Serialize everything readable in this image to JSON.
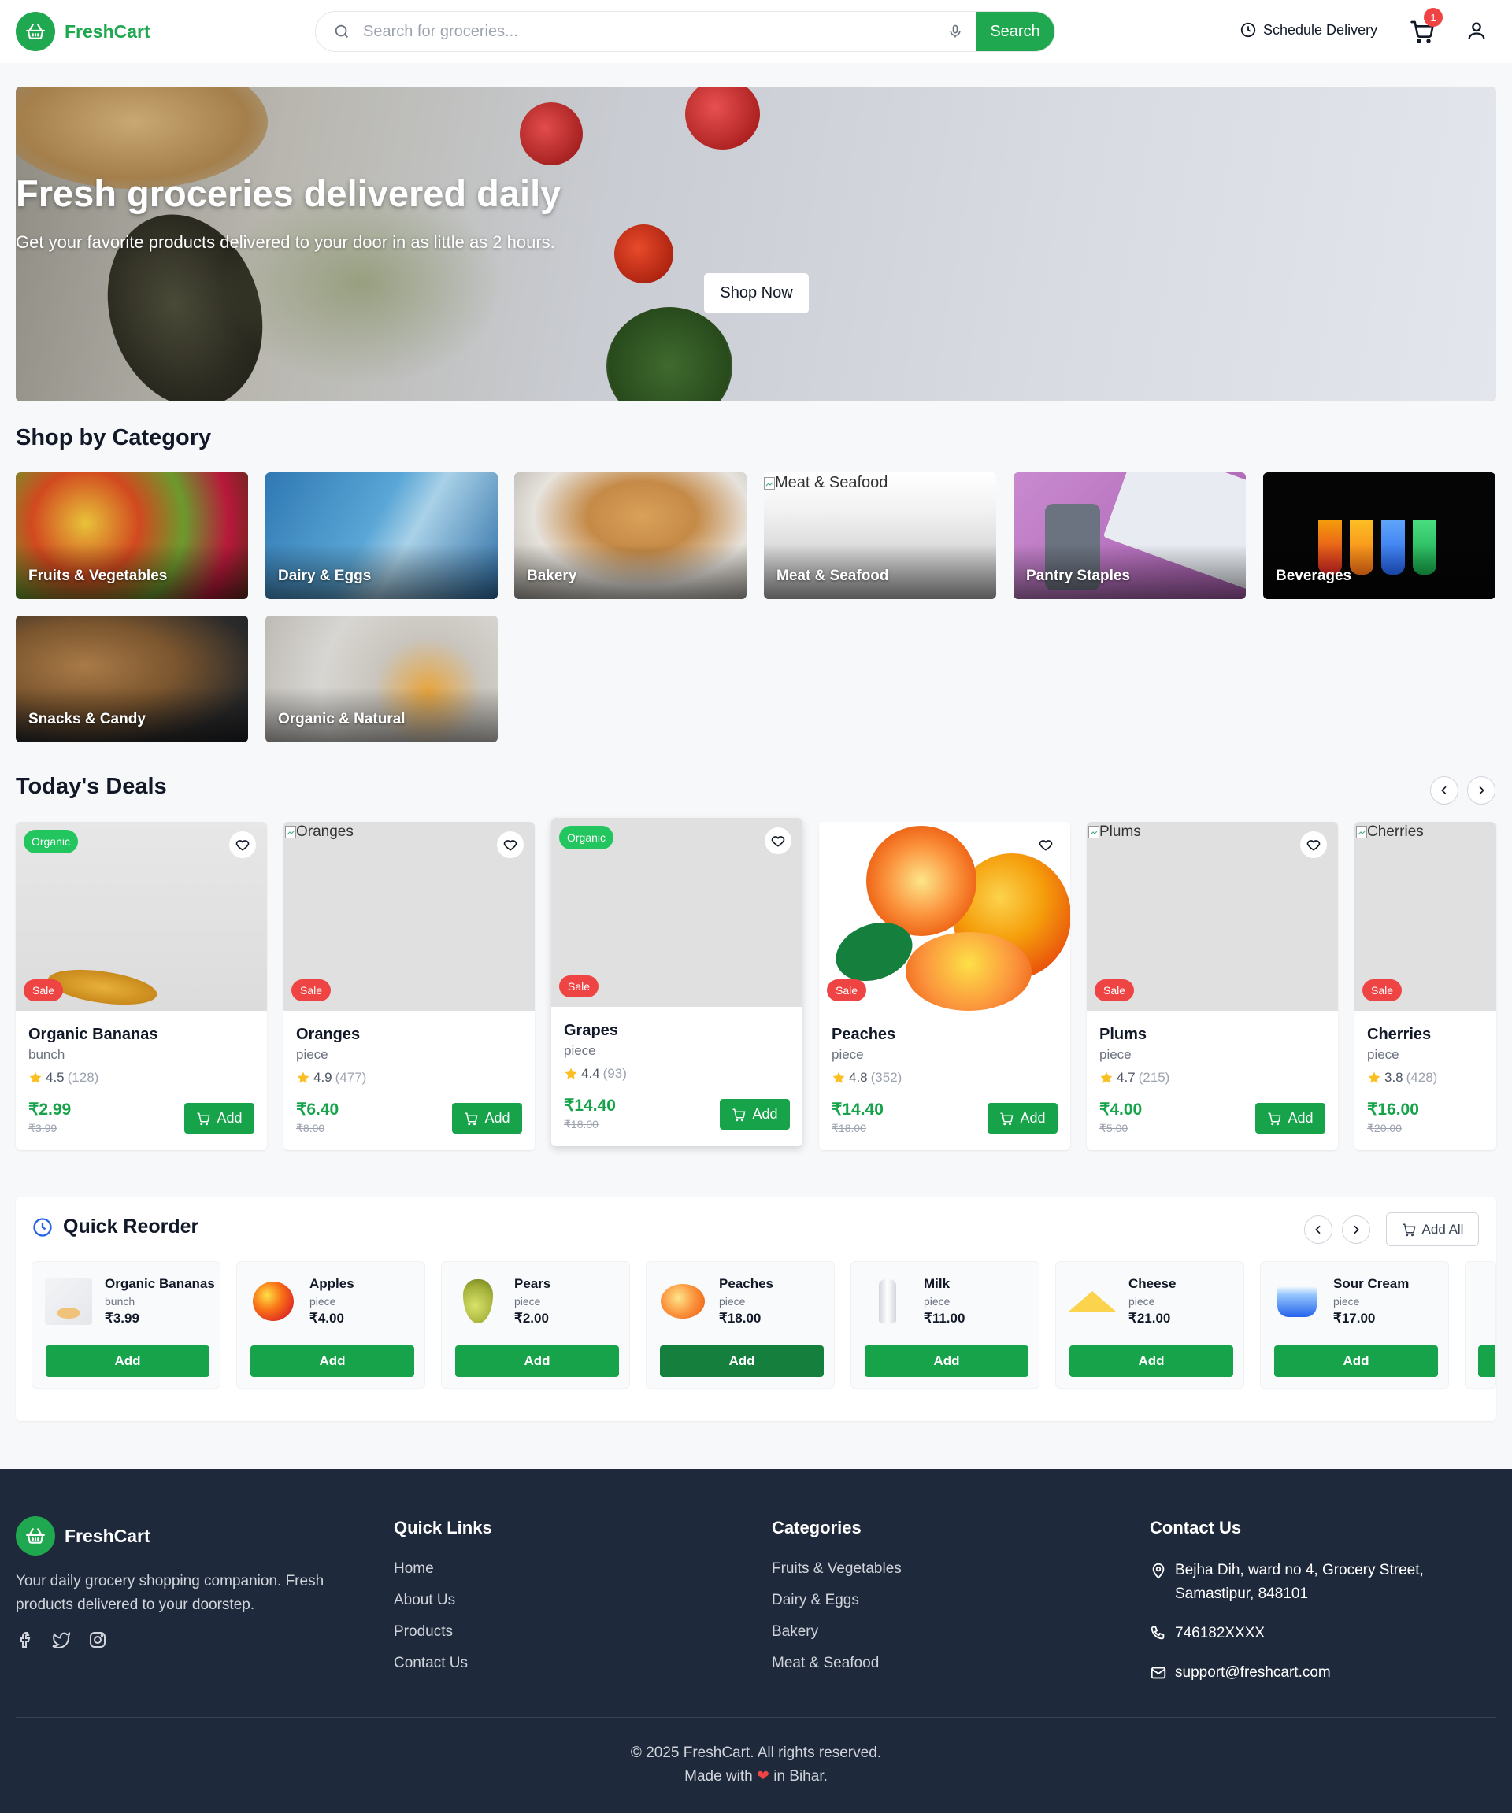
{
  "brand": {
    "name": "FreshCart"
  },
  "header": {
    "search_placeholder": "Search for groceries...",
    "search_button": "Search",
    "schedule_label": "Schedule Delivery",
    "cart_count": "1"
  },
  "hero": {
    "title": "Fresh groceries delivered daily",
    "subtitle": "Get your favorite products delivered to your door in as little as 2 hours.",
    "cta": "Shop Now"
  },
  "categories": {
    "title": "Shop by Category",
    "items": [
      {
        "label": "Fruits & Vegetables"
      },
      {
        "label": "Dairy & Eggs"
      },
      {
        "label": "Bakery"
      },
      {
        "label": "Meat & Seafood",
        "alt": "Meat & Seafood"
      },
      {
        "label": "Pantry Staples"
      },
      {
        "label": "Beverages"
      },
      {
        "label": "Snacks & Candy"
      },
      {
        "label": "Organic & Natural"
      }
    ]
  },
  "deals": {
    "title": "Today's Deals",
    "add_label": "Add",
    "items": [
      {
        "name": "Organic Bananas",
        "unit": "bunch",
        "rating": "4.5",
        "reviews": "(128)",
        "price": "₹2.99",
        "old_price": "₹3.99",
        "organic": "Organic",
        "sale": "Sale"
      },
      {
        "name": "Oranges",
        "unit": "piece",
        "rating": "4.9",
        "reviews": "(477)",
        "price": "₹6.40",
        "old_price": "₹8.00",
        "sale": "Sale",
        "alt": "Oranges"
      },
      {
        "name": "Grapes",
        "unit": "piece",
        "rating": "4.4",
        "reviews": "(93)",
        "price": "₹14.40",
        "old_price": "₹18.00",
        "organic": "Organic",
        "sale": "Sale"
      },
      {
        "name": "Peaches",
        "unit": "piece",
        "rating": "4.8",
        "reviews": "(352)",
        "price": "₹14.40",
        "old_price": "₹18.00",
        "sale": "Sale"
      },
      {
        "name": "Plums",
        "unit": "piece",
        "rating": "4.7",
        "reviews": "(215)",
        "price": "₹4.00",
        "old_price": "₹5.00",
        "sale": "Sale",
        "alt": "Plums"
      },
      {
        "name": "Cherries",
        "unit": "piece",
        "rating": "3.8",
        "reviews": "(428)",
        "price": "₹16.00",
        "old_price": "₹20.00",
        "sale": "Sale",
        "alt": "Cherries"
      }
    ]
  },
  "quick_reorder": {
    "title": "Quick Reorder",
    "add_all": "Add All",
    "add_label": "Add",
    "items": [
      {
        "name": "Organic Bananas",
        "unit": "bunch",
        "price": "₹3.99"
      },
      {
        "name": "Apples",
        "unit": "piece",
        "price": "₹4.00"
      },
      {
        "name": "Pears",
        "unit": "piece",
        "price": "₹2.00"
      },
      {
        "name": "Peaches",
        "unit": "piece",
        "price": "₹18.00"
      },
      {
        "name": "Milk",
        "unit": "piece",
        "price": "₹11.00"
      },
      {
        "name": "Cheese",
        "unit": "piece",
        "price": "₹21.00"
      },
      {
        "name": "Sour Cream",
        "unit": "piece",
        "price": "₹17.00"
      }
    ]
  },
  "footer": {
    "description": "Your daily grocery shopping companion. Fresh products delivered to your doorstep.",
    "quick_links_title": "Quick Links",
    "quick_links": [
      "Home",
      "About Us",
      "Products",
      "Contact Us"
    ],
    "categories_title": "Categories",
    "categories": [
      "Fruits & Vegetables",
      "Dairy & Eggs",
      "Bakery",
      "Meat & Seafood"
    ],
    "contact_title": "Contact Us",
    "address": "Bejha Dih, ward no 4, Grocery Street, Samastipur, 848101",
    "phone": "746182XXXX",
    "email": "support@freshcart.com",
    "copyright": "© 2025 FreshCart. All rights reserved.",
    "made_with_prefix": "Made with",
    "made_with_suffix": "in Bihar."
  },
  "colors": {
    "brand": "#1fa84f",
    "sale": "#ef4444",
    "footer_bg": "#1e293b"
  }
}
